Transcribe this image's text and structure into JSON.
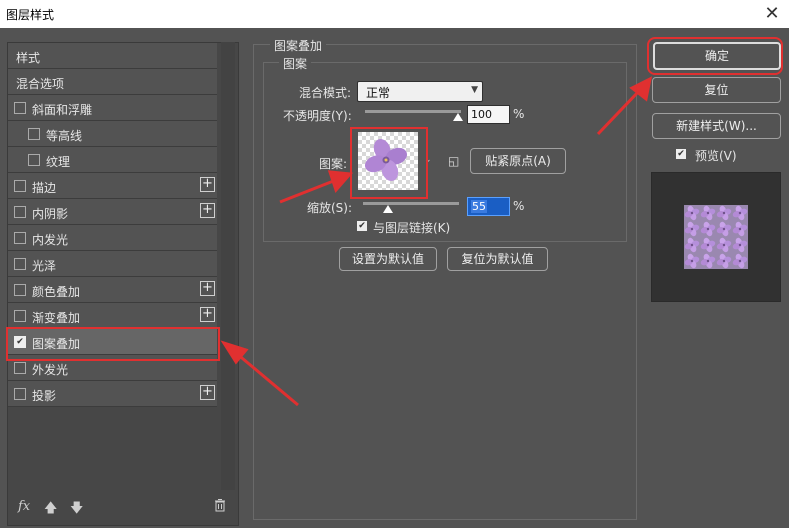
{
  "window": {
    "title": "图层样式",
    "close_icon": "close-icon"
  },
  "sidebar": {
    "items": [
      {
        "label": "样式",
        "checkbox": false,
        "checked": false,
        "plus": false,
        "indent": false
      },
      {
        "label": "混合选项",
        "checkbox": false,
        "checked": false,
        "plus": false,
        "indent": false
      },
      {
        "label": "斜面和浮雕",
        "checkbox": true,
        "checked": false,
        "plus": false,
        "indent": false
      },
      {
        "label": "等高线",
        "checkbox": true,
        "checked": false,
        "plus": false,
        "indent": true
      },
      {
        "label": "纹理",
        "checkbox": true,
        "checked": false,
        "plus": false,
        "indent": true
      },
      {
        "label": "描边",
        "checkbox": true,
        "checked": false,
        "plus": true,
        "indent": false
      },
      {
        "label": "内阴影",
        "checkbox": true,
        "checked": false,
        "plus": true,
        "indent": false
      },
      {
        "label": "内发光",
        "checkbox": true,
        "checked": false,
        "plus": false,
        "indent": false
      },
      {
        "label": "光泽",
        "checkbox": true,
        "checked": false,
        "plus": false,
        "indent": false
      },
      {
        "label": "颜色叠加",
        "checkbox": true,
        "checked": false,
        "plus": true,
        "indent": false
      },
      {
        "label": "渐变叠加",
        "checkbox": true,
        "checked": false,
        "plus": true,
        "indent": false
      },
      {
        "label": "图案叠加",
        "checkbox": true,
        "checked": true,
        "plus": false,
        "indent": false
      },
      {
        "label": "外发光",
        "checkbox": true,
        "checked": false,
        "plus": false,
        "indent": false
      },
      {
        "label": "投影",
        "checkbox": true,
        "checked": false,
        "plus": true,
        "indent": false
      }
    ],
    "bottom": {
      "fx": "fx",
      "up_icon": "arrow-up-icon",
      "down_icon": "arrow-down-icon",
      "trash_icon": "trash-icon"
    }
  },
  "pattern_overlay": {
    "group_title": "图案叠加",
    "sub_title": "图案",
    "blend_mode_label": "混合模式:",
    "blend_mode_value": "正常",
    "opacity_label": "不透明度(Y):",
    "opacity_value": "100",
    "opacity_unit": "%",
    "opacity_fraction": 1.0,
    "pattern_label": "图案:",
    "snap_button": "贴紧原点(A)",
    "scale_label": "缩放(S):",
    "scale_value": "55",
    "scale_unit": "%",
    "link_label": "与图层链接(K)",
    "link_checked": true,
    "set_default_button": "设置为默认值",
    "reset_default_button": "复位为默认值"
  },
  "right": {
    "ok_button": "确定",
    "reset_button": "复位",
    "new_style_button": "新建样式(W)...",
    "preview_label": "预览(V)",
    "preview_checked": true
  },
  "colors": {
    "annotation_red": "#e03030",
    "flower_purple": "#b48ad6"
  }
}
